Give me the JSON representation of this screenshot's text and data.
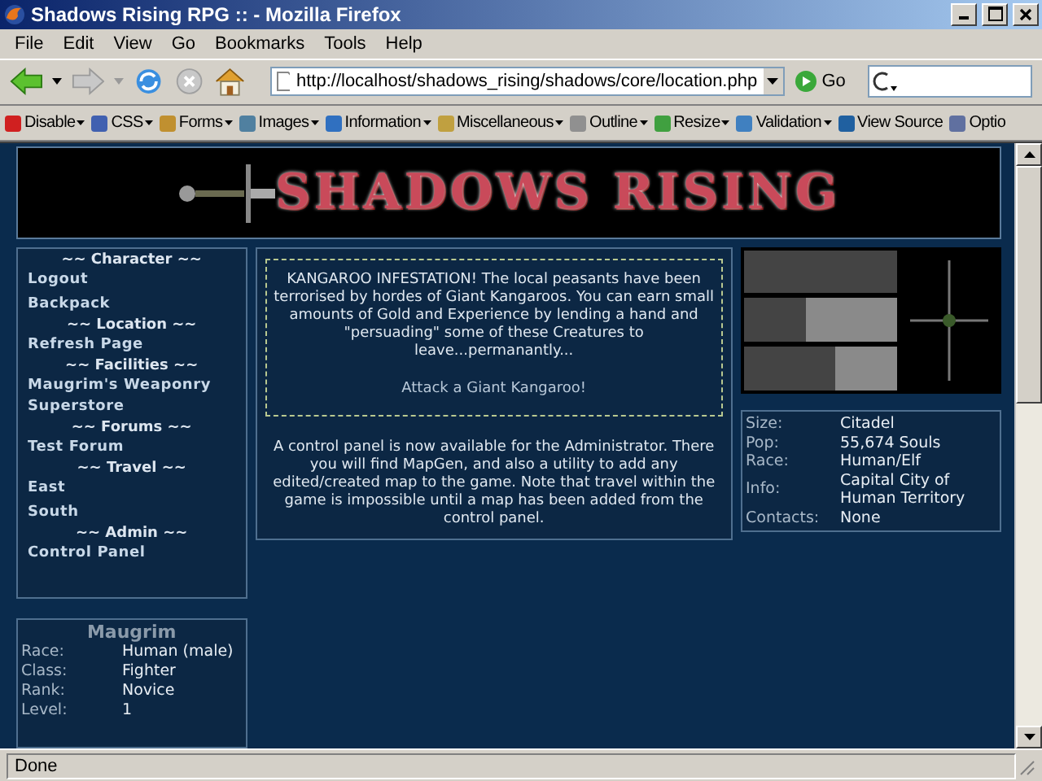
{
  "window": {
    "title": "Shadows Rising RPG :: - Mozilla Firefox"
  },
  "menu_bar": [
    "File",
    "Edit",
    "View",
    "Go",
    "Bookmarks",
    "Tools",
    "Help"
  ],
  "nav_toolbar": {
    "address": "http://localhost/shadows_rising/shadows/core/location.php",
    "go_label": "Go"
  },
  "developer_toolbar": [
    {
      "label": "Disable",
      "dropdown": true
    },
    {
      "label": "CSS",
      "dropdown": true
    },
    {
      "label": "Forms",
      "dropdown": true
    },
    {
      "label": "Images",
      "dropdown": true
    },
    {
      "label": "Information",
      "dropdown": true
    },
    {
      "label": "Miscellaneous",
      "dropdown": true
    },
    {
      "label": "Outline",
      "dropdown": true
    },
    {
      "label": "Resize",
      "dropdown": true
    },
    {
      "label": "Validation",
      "dropdown": true
    },
    {
      "label": "View Source",
      "dropdown": false
    },
    {
      "label": "Optio",
      "dropdown": false
    }
  ],
  "banner": {
    "logo_text": "SHADOWS RISING"
  },
  "sidebar": {
    "sections": [
      {
        "heading": "~~ Character ~~",
        "links": [
          "Logout",
          "Backpack"
        ]
      },
      {
        "heading": "~~ Location ~~",
        "links": [
          "Refresh Page"
        ]
      },
      {
        "heading": "~~ Facilities ~~",
        "links": [
          "Maugrim's Weaponry Superstore"
        ]
      },
      {
        "heading": "~~ Forums ~~",
        "links": [
          "Test Forum"
        ]
      },
      {
        "heading": "~~ Travel ~~",
        "links": [
          "East",
          "South"
        ]
      },
      {
        "heading": "~~ Admin ~~",
        "links": [
          "Control Panel"
        ]
      }
    ]
  },
  "news": {
    "announcement": "KANGAROO INFESTATION! The local peasants have been terrorised by hordes of Giant Kangaroos. You can earn small amounts of Gold and Experience by lending a hand and \"persuading\" some of these Creatures to leave...permanantly...",
    "action_link": "Attack a Giant Kangaroo!",
    "notice": "A control panel is now available for the Administrator. There you will find MapGen, and also a utility to add any edited/created map to the game. Note that travel within the game is impossible until a map has been added from the control panel."
  },
  "location": {
    "details": [
      {
        "label": "Size:",
        "value": "Citadel"
      },
      {
        "label": "Pop:",
        "value": "55,674 Souls"
      },
      {
        "label": "Race:",
        "value": "Human/Elf"
      },
      {
        "label": "Info:",
        "value": "Capital City of Human Territory"
      },
      {
        "label": "Contacts:",
        "value": "None"
      }
    ]
  },
  "character": {
    "name": "Maugrim",
    "stats": [
      {
        "label": "Race:",
        "value": "Human (male)"
      },
      {
        "label": "Class:",
        "value": "Fighter"
      },
      {
        "label": "Rank:",
        "value": "Novice"
      },
      {
        "label": "Level:",
        "value": "1"
      }
    ]
  },
  "status_bar": {
    "text": "Done"
  }
}
